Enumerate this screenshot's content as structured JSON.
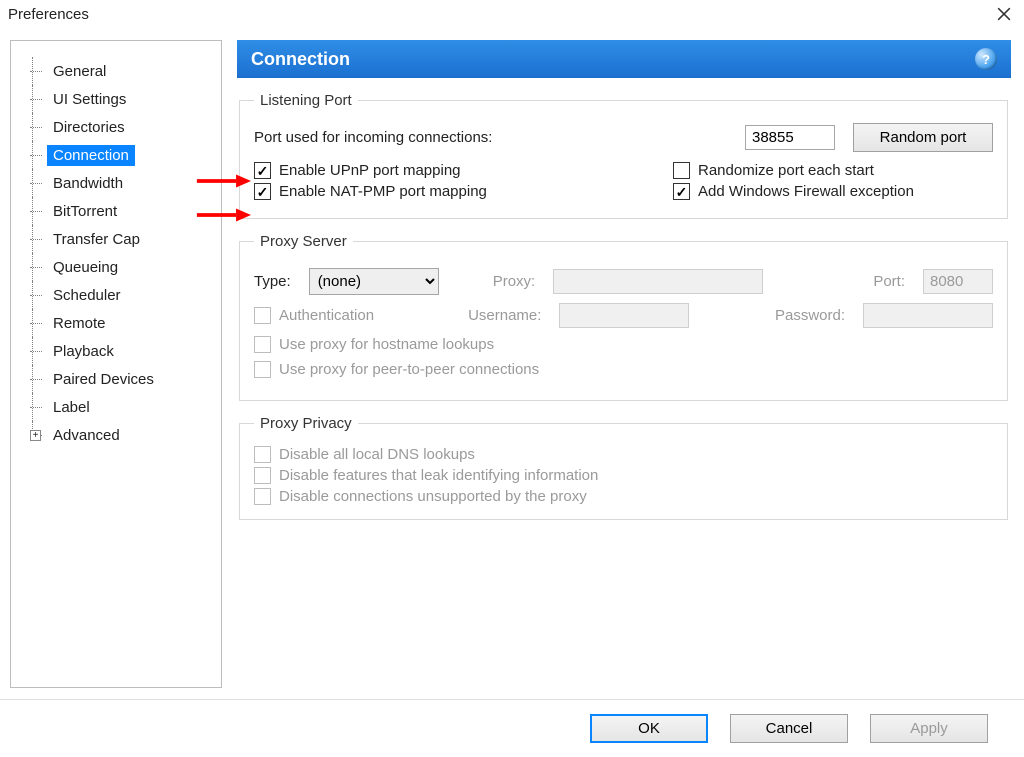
{
  "window": {
    "title": "Preferences"
  },
  "sidebar": {
    "items": [
      {
        "label": "General"
      },
      {
        "label": "UI Settings"
      },
      {
        "label": "Directories"
      },
      {
        "label": "Connection",
        "selected": true
      },
      {
        "label": "Bandwidth"
      },
      {
        "label": "BitTorrent"
      },
      {
        "label": "Transfer Cap"
      },
      {
        "label": "Queueing"
      },
      {
        "label": "Scheduler"
      },
      {
        "label": "Remote"
      },
      {
        "label": "Playback"
      },
      {
        "label": "Paired Devices"
      },
      {
        "label": "Label"
      },
      {
        "label": "Advanced",
        "expandable": true
      }
    ]
  },
  "panel": {
    "title": "Connection",
    "listening": {
      "legend": "Listening Port",
      "port_label": "Port used for incoming connections:",
      "port_value": "38855",
      "random_btn": "Random port",
      "upnp": "Enable UPnP port mapping",
      "natpmp": "Enable NAT-PMP port mapping",
      "randomize": "Randomize port each start",
      "firewall": "Add Windows Firewall exception"
    },
    "proxy": {
      "legend": "Proxy Server",
      "type_label": "Type:",
      "type_value": "(none)",
      "proxy_label": "Proxy:",
      "proxy_value": "",
      "port_label": "Port:",
      "port_value": "8080",
      "auth": "Authentication",
      "user_label": "Username:",
      "user_value": "",
      "pass_label": "Password:",
      "pass_value": "",
      "hostname": "Use proxy for hostname lookups",
      "p2p": "Use proxy for peer-to-peer connections"
    },
    "privacy": {
      "legend": "Proxy Privacy",
      "dns": "Disable all local DNS lookups",
      "leak": "Disable features that leak identifying information",
      "unsupported": "Disable connections unsupported by the proxy"
    }
  },
  "footer": {
    "ok": "OK",
    "cancel": "Cancel",
    "apply": "Apply"
  }
}
